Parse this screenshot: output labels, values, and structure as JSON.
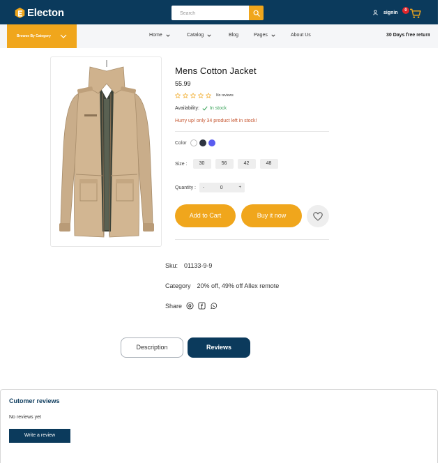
{
  "header": {
    "brand": "Electon",
    "search_placeholder": "Search",
    "signin_label": "signin",
    "cart_count": "0"
  },
  "nav": {
    "browse_label": "Browse By Category",
    "items": [
      {
        "label": "Home"
      },
      {
        "label": "Catalog"
      },
      {
        "label": "Blog"
      },
      {
        "label": "Pages"
      },
      {
        "label": "About Us"
      }
    ],
    "promo": "30 Days free return"
  },
  "product": {
    "title": "Mens Cotton Jacket",
    "price": "55.99",
    "rating": 0,
    "reviews_label": "No reviews",
    "availability_label": "Availability:",
    "stock_status": "In stock",
    "stock_note": "Hurry up! only 34 product left in stock!",
    "color_label": "Color",
    "colors": [
      "#ffffff",
      "#2e3440",
      "#5a5cf0"
    ],
    "size_label": "Size :",
    "sizes": [
      "30",
      "56",
      "42",
      "48"
    ],
    "quantity_label": "Quantity :",
    "quantity_minus": "-",
    "quantity_value": "0",
    "quantity_plus": "+",
    "add_to_cart": "Add to Cart",
    "buy_now": "Buy it now",
    "wishlist_icon": "heart-icon"
  },
  "meta": {
    "sku_label": "Sku:",
    "sku_value": "01133-9-9",
    "category_label": "Category",
    "category_value": "20% off, 49% off Allex remote",
    "share_label": "Share",
    "share_icons": [
      "google-icon",
      "facebook-icon",
      "whatsapp-icon"
    ]
  },
  "tabs": {
    "description": "Description",
    "reviews": "Reviews"
  },
  "reviews": {
    "title": "Cutomer reviews",
    "empty_text": "No reviews yet",
    "write_button": "Write a review"
  },
  "colors": {
    "primary": "#0b3a5c",
    "accent": "#f0a61c",
    "stock_green": "#3aa35a",
    "badge_red": "#e0262b"
  }
}
